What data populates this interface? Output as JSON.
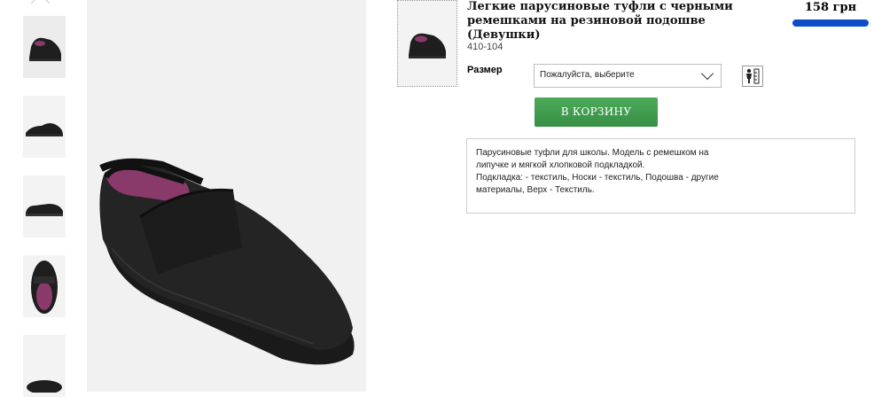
{
  "product": {
    "title": "Легкие парусиновые туфли с черными ремешками на резиновой подошве (Девушки)",
    "sku": "410-104",
    "price": "158 грн",
    "size_label": "Размер",
    "size_placeholder": "Пожалуйста, выберите",
    "add_to_cart_label": "В КОРЗИНУ",
    "description_1": "Парусиновые туфли для школы. Модель с ремешком на липучке и мягкой хлопковой подкладкой.",
    "description_2": "Подкладка: - текстиль, Носки - текстиль, Подошва - другие материалы, Верх - Текстиль."
  },
  "colors": {
    "accent_blue": "#0a4fc8",
    "cart_green": "#41a050",
    "shoe": "#1e1e1e",
    "lining": "#8a3a6a"
  },
  "icons": [
    "chevron-up-icon",
    "chevron-down-icon",
    "size-guide-icon"
  ]
}
